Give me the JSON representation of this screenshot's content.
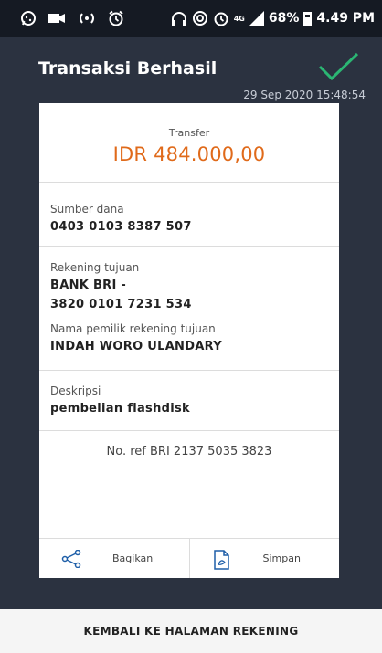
{
  "status_bar": {
    "battery": "68%",
    "time": "4.49 PM",
    "network": "4G"
  },
  "header": {
    "title": "Transaksi Berhasil",
    "datetime": "29 Sep 2020 15:48:54",
    "success_color": "#2bb673"
  },
  "receipt": {
    "transfer_label": "Transfer",
    "amount": "IDR 484.000,00",
    "amount_color": "#e06a1a",
    "source_label": "Sumber dana",
    "source_value": "0403 0103 8387 507",
    "dest_label": "Rekening tujuan",
    "dest_bank": "BANK BRI -",
    "dest_account": "3820 0101 7231 534",
    "owner_label": "Nama pemilik rekening tujuan",
    "owner_value": "INDAH WORO ULANDARY",
    "desc_label": "Deskripsi",
    "desc_value": "pembelian flashdisk",
    "ref": "No. ref BRI 2137 5035 3823"
  },
  "actions": {
    "share_label": "Bagikan",
    "share_icon": "share-icon",
    "save_label": "Simpan",
    "save_icon": "save-file-icon"
  },
  "footer": {
    "back_label": "KEMBALI KE HALAMAN REKENING"
  }
}
